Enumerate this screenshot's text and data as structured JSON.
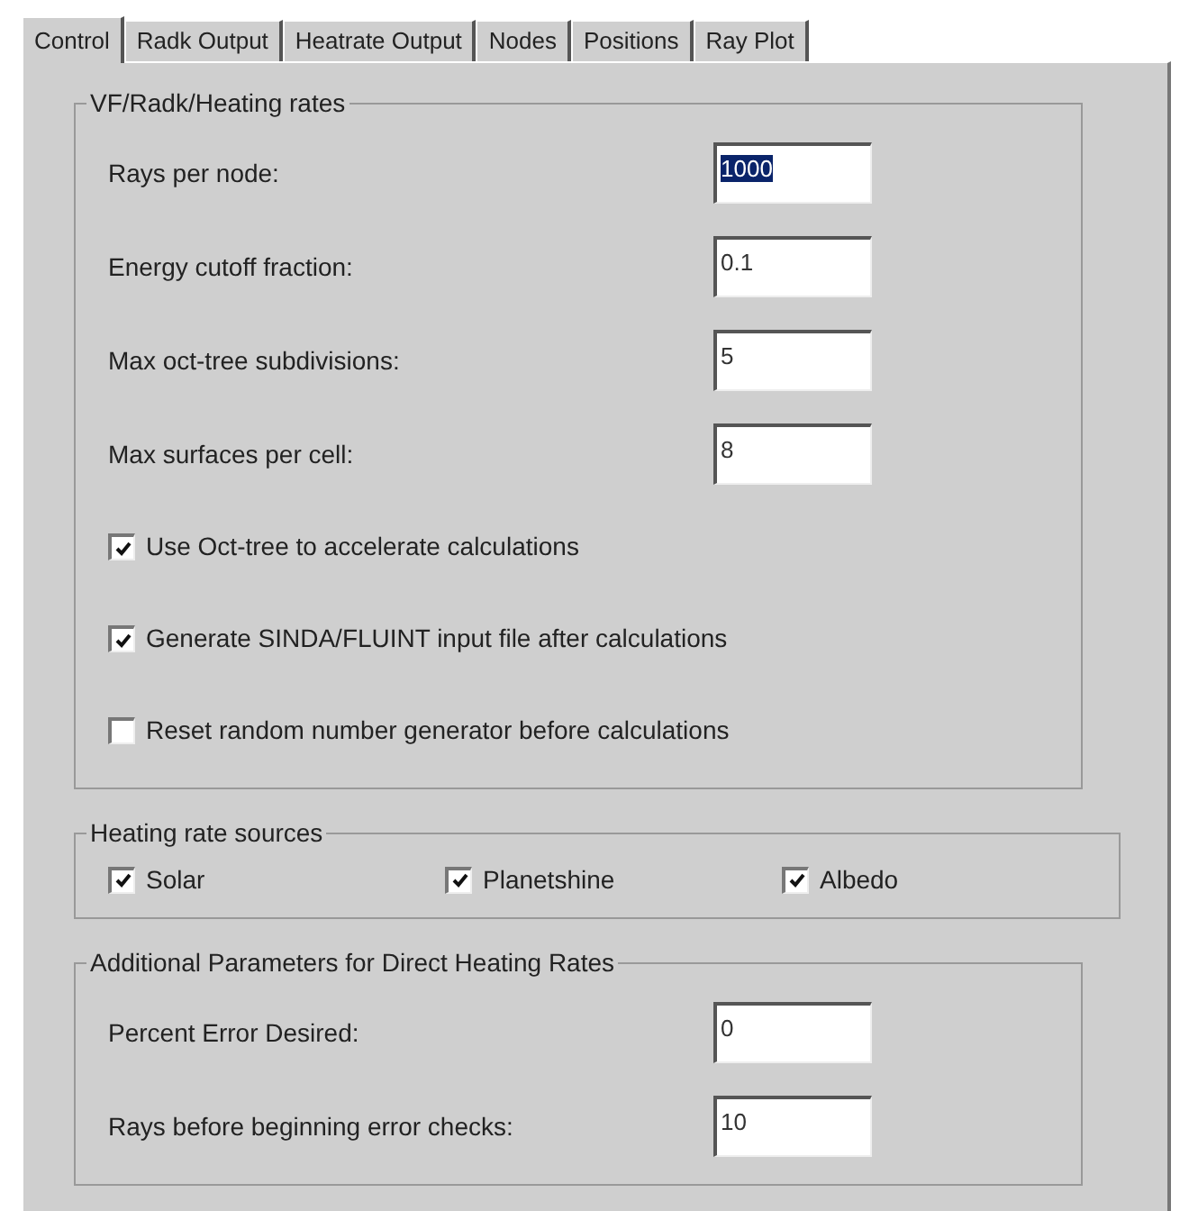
{
  "tabs": [
    {
      "label": "Control",
      "selected": true
    },
    {
      "label": "Radk Output",
      "selected": false
    },
    {
      "label": "Heatrate Output",
      "selected": false
    },
    {
      "label": "Nodes",
      "selected": false
    },
    {
      "label": "Positions",
      "selected": false
    },
    {
      "label": "Ray Plot",
      "selected": false
    }
  ],
  "groups": [
    {
      "title": "VF/Radk/Heating rates",
      "kind": "rows",
      "items": [
        {
          "kind": "field",
          "label": "Rays per node:",
          "value": "1000",
          "highlighted": true
        },
        {
          "kind": "field",
          "label": "Energy cutoff fraction:",
          "value": "0.1",
          "highlighted": false
        },
        {
          "kind": "field",
          "label": "Max oct-tree subdivisions:",
          "value": "5",
          "highlighted": false
        },
        {
          "kind": "field",
          "label": "Max surfaces per cell:",
          "value": "8",
          "highlighted": false
        },
        {
          "kind": "checkbox",
          "label": "Use Oct-tree to accelerate calculations",
          "checked": true
        },
        {
          "kind": "checkbox",
          "label": "Generate SINDA/FLUINT input file after calculations",
          "checked": true
        },
        {
          "kind": "checkbox",
          "label": "Reset random number generator before calculations",
          "checked": false
        }
      ]
    },
    {
      "title": "Heating rate sources",
      "kind": "inline",
      "items": [
        {
          "kind": "checkbox",
          "label": "Solar",
          "checked": true
        },
        {
          "kind": "checkbox",
          "label": "Planetshine",
          "checked": true
        },
        {
          "kind": "checkbox",
          "label": "Albedo",
          "checked": true
        }
      ]
    },
    {
      "title": "Additional Parameters for Direct Heating Rates",
      "kind": "rows",
      "items": [
        {
          "kind": "field",
          "label": "Percent Error Desired:",
          "value": "0",
          "highlighted": false
        },
        {
          "kind": "field",
          "label": "Rays before beginning error checks:",
          "value": "10",
          "highlighted": false
        }
      ]
    }
  ]
}
